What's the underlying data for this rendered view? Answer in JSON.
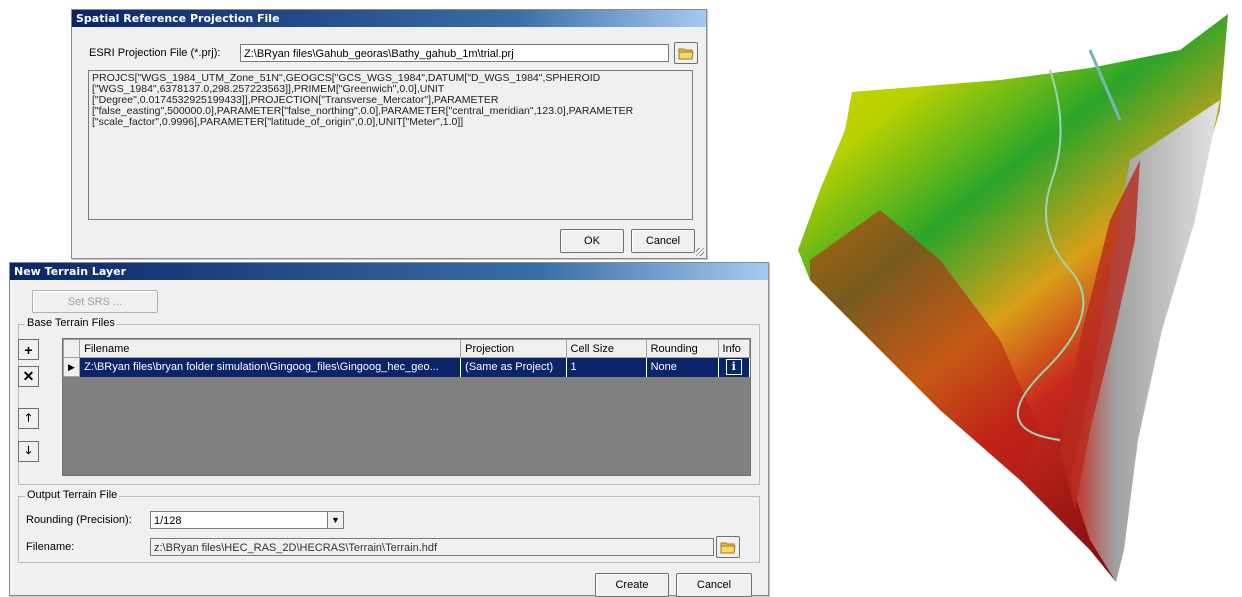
{
  "srs_dialog": {
    "title": "Spatial Reference Projection File",
    "file_label": "ESRI Projection File (*.prj):",
    "file_value": "Z:\\BRyan files\\Gahub_georas\\Bathy_gahub_1m\\trial.prj",
    "wkt_lines": [
      "PROJCS[\"WGS_1984_UTM_Zone_51N\",GEOGCS[\"GCS_WGS_1984\",DATUM[\"D_WGS_1984\",SPHEROID",
      "[\"WGS_1984\",6378137.0,298.257223563]],PRIMEM[\"Greenwich\",0.0],UNIT",
      "[\"Degree\",0.0174532925199433]],PROJECTION[\"Transverse_Mercator\"],PARAMETER",
      "[\"false_easting\",500000.0],PARAMETER[\"false_northing\",0.0],PARAMETER[\"central_meridian\",123.0],PARAMETER",
      "[\"scale_factor\",0.9996],PARAMETER[\"latitude_of_origin\",0.0],UNIT[\"Meter\",1.0]]"
    ],
    "ok_label": "OK",
    "cancel_label": "Cancel"
  },
  "terrain_dialog": {
    "title": "New Terrain Layer",
    "set_srs_label": "Set SRS ...",
    "base_group_label": "Base Terrain Files",
    "columns": [
      "Filename",
      "Projection",
      "Cell Size",
      "Rounding",
      "Info"
    ],
    "rows": [
      {
        "filename": "Z:\\BRyan files\\bryan folder simulation\\Gingoog_files\\Gingoog_hec_geo...",
        "projection": "(Same as Project)",
        "cell_size": "1",
        "rounding": "None",
        "info": "i"
      }
    ],
    "output_group_label": "Output Terrain File",
    "rounding_label": "Rounding (Precision):",
    "rounding_value": "1/128",
    "filename_label": "Filename:",
    "filename_value": "z:\\BRyan files\\HEC_RAS_2D\\HECRAS\\Terrain\\Terrain.hdf",
    "create_label": "Create",
    "cancel_label": "Cancel"
  },
  "map": {
    "colors": {
      "low": "#c8d400",
      "mid": "#1e9a1e",
      "high": "#c8281e",
      "hill": "#9a9a9a"
    }
  }
}
